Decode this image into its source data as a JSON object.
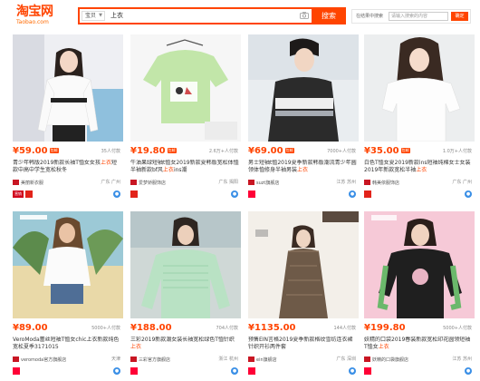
{
  "header": {
    "logo": "淘宝网",
    "logo_sub": "Taobao.com",
    "search": {
      "category": "宝贝",
      "query": "上衣",
      "button": "搜索"
    },
    "filter": {
      "label": "在结果中搜索",
      "placeholder": "请输入搜索的内容",
      "button": "确定"
    }
  },
  "products": [
    {
      "price": "¥59.00",
      "tag": "包邮",
      "sales": "35人付款",
      "title_a": "青少年韩版2019新款长袖T恤女女孩",
      "title_hl": "上衣",
      "title_b": "短款中高中学生宽松秋冬",
      "shop": "美丽新衣服",
      "location": "广东 广州"
    },
    {
      "price": "¥19.80",
      "tag": "包邮",
      "sales": "2.6万+人付款",
      "title_a": "牛油果绿短袖t恤女2019新款夏韩版宽松体恤半袖新款bf风",
      "title_hl": "上衣",
      "title_b": "ins潮",
      "shop": "爱梦娇服饰店",
      "location": "广东 揭阳"
    },
    {
      "price": "¥69.00",
      "tag": "包邮",
      "sales": "7000+人付款",
      "title_a": "男士短袖t恤2019夏季新款韩版潮流青少年圆领体恤修身半袖男装",
      "title_hl": "上衣",
      "title_b": "",
      "shop": "suzt旗舰店",
      "location": "江苏 苏州"
    },
    {
      "price": "¥35.00",
      "tag": "包邮",
      "sales": "1.0万+人付款",
      "title_a": "白色T恤女夏2019新款ins短袖纯棉女士女装2019年新款宽松半袖",
      "title_hl": "上衣",
      "title_b": "",
      "shop": "韩美依服饰店",
      "location": "广东 广州"
    },
    {
      "price": "¥89.00",
      "tag": "",
      "sales": "5000+人付款",
      "title_a": "VeroModa蕾丝短袖T恤女chic上衣新款纯色宽松夏季3171015",
      "title_hl": "",
      "title_b": "",
      "shop": "veromoda官方旗舰店",
      "location": "天津"
    },
    {
      "price": "¥188.00",
      "tag": "",
      "sales": "704人付款",
      "title_a": "三彩2019新款潮女装长袖宽松绿色T恤针织",
      "title_hl": "上衣",
      "title_b": "",
      "shop": "三彩官方旗舰店",
      "location": "浙江 杭州"
    },
    {
      "price": "¥1135.00",
      "tag": "",
      "sales": "144人付款",
      "title_a": "预售EIN言格2019夏季新款格纹雪纺连衣裙针织开衫两件套",
      "title_hl": "",
      "title_b": "",
      "shop": "ein旗舰店",
      "location": "广东 深圳"
    },
    {
      "price": "¥199.80",
      "tag": "",
      "sales": "5000+人付款",
      "title_a": "妖精的口袋2019春装新款宽松印花圆领短袖T恤女",
      "title_hl": "上衣",
      "title_b": "",
      "shop": "妖精的口袋旗舰店",
      "location": "江苏 苏州"
    }
  ],
  "colors": {
    "brand": "#ff4400"
  }
}
